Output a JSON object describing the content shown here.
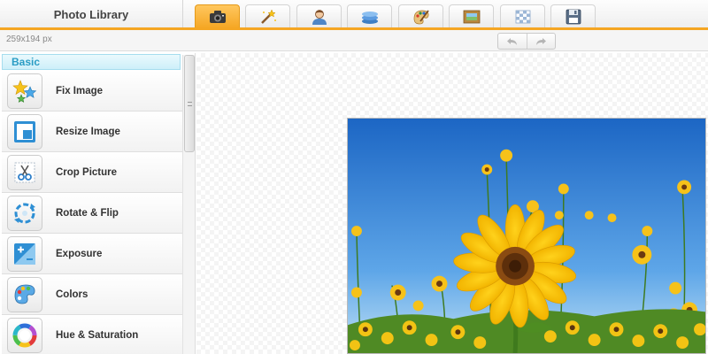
{
  "app": {
    "title": "Photo Library"
  },
  "tabs": [
    {
      "icon": "camera-icon",
      "active": true
    },
    {
      "icon": "magic-wand-icon",
      "active": false
    },
    {
      "icon": "person-icon",
      "active": false
    },
    {
      "icon": "layers-icon",
      "active": false
    },
    {
      "icon": "palette-brush-icon",
      "active": false
    },
    {
      "icon": "frame-icon",
      "active": false
    },
    {
      "icon": "texture-icon",
      "active": false
    },
    {
      "icon": "save-icon",
      "active": false
    }
  ],
  "infobar": {
    "dimensions": "259x194 px"
  },
  "history": {
    "undo_icon": "undo-icon",
    "redo_icon": "redo-icon"
  },
  "sidebar": {
    "section_title": "Basic",
    "items": [
      {
        "label": "Fix Image",
        "icon": "stars-icon"
      },
      {
        "label": "Resize Image",
        "icon": "resize-icon"
      },
      {
        "label": "Crop Picture",
        "icon": "scissors-icon"
      },
      {
        "label": "Rotate & Flip",
        "icon": "rotate-icon"
      },
      {
        "label": "Exposure",
        "icon": "exposure-icon"
      },
      {
        "label": "Colors",
        "icon": "palette-icon"
      },
      {
        "label": "Hue & Saturation",
        "icon": "color-wheel-icon"
      }
    ]
  },
  "colors": {
    "accent": "#f5a623",
    "section": "#2a9cc4"
  },
  "canvas": {
    "image": "sunflower-photo"
  }
}
